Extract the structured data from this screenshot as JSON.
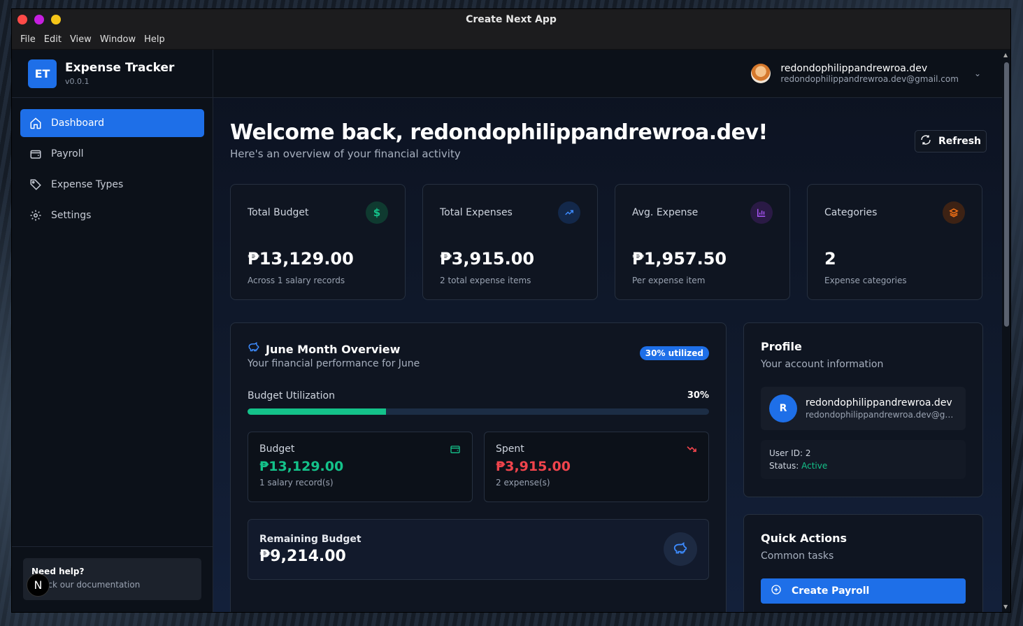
{
  "window": {
    "title": "Create Next App",
    "traffic_colors": [
      "#ff4a48",
      "#c61fe0",
      "#f5c518"
    ]
  },
  "menu": [
    "File",
    "Edit",
    "View",
    "Window",
    "Help"
  ],
  "sidebar": {
    "brand_initials": "ET",
    "brand_title": "Expense Tracker",
    "brand_version": "v0.0.1",
    "items": [
      {
        "label": "Dashboard",
        "icon": "home-icon",
        "active": true
      },
      {
        "label": "Payroll",
        "icon": "wallet-icon"
      },
      {
        "label": "Expense Types",
        "icon": "tag-icon"
      },
      {
        "label": "Settings",
        "icon": "gear-icon"
      }
    ],
    "help_title": "Need help?",
    "help_text": "Check our documentation",
    "help_badge": "N"
  },
  "topbar": {
    "user_name": "redondophilippandrewroa.dev",
    "user_email": "redondophilippandrewroa.dev@gmail.com"
  },
  "header": {
    "welcome": "Welcome back, redondophilippandrewroa.dev!",
    "subtitle": "Here's an overview of your financial activity",
    "refresh_label": "Refresh"
  },
  "stats": [
    {
      "label": "Total Budget",
      "value": "₱13,129.00",
      "desc": "Across 1 salary records",
      "icon": "dollar-icon",
      "color": "#14c28a"
    },
    {
      "label": "Total Expenses",
      "value": "₱3,915.00",
      "desc": "2 total expense items",
      "icon": "trending-up-icon",
      "color": "#3d8bff"
    },
    {
      "label": "Avg. Expense",
      "value": "₱1,957.50",
      "desc": "Per expense item",
      "icon": "bar-chart-icon",
      "color": "#a855f7"
    },
    {
      "label": "Categories",
      "value": "2",
      "desc": "Expense categories",
      "icon": "layers-icon",
      "color": "#f97316"
    }
  ],
  "overview": {
    "title": "June Month Overview",
    "subtitle": "Your financial performance for June",
    "badge": "30% utilized",
    "util_label": "Budget Utilization",
    "util_pct_text": "30%",
    "util_fraction": 0.3,
    "budget": {
      "label": "Budget",
      "value": "₱13,129.00",
      "desc": "1 salary record(s)",
      "color": "#14c28a"
    },
    "spent": {
      "label": "Spent",
      "value": "₱3,915.00",
      "desc": "2 expense(s)",
      "color": "#f0444c"
    },
    "remaining": {
      "label": "Remaining Budget",
      "value": "₱9,214.00"
    }
  },
  "profile": {
    "title": "Profile",
    "subtitle": "Your account information",
    "avatar_initial": "R",
    "name": "redondophilippandrewroa.dev",
    "email": "redondophilippandrewroa.dev@gmail.com",
    "user_id_label": "User ID:",
    "user_id": "2",
    "status_label": "Status:",
    "status": "Active"
  },
  "quick_actions": {
    "title": "Quick Actions",
    "subtitle": "Common tasks",
    "create_payroll": "Create Payroll"
  }
}
